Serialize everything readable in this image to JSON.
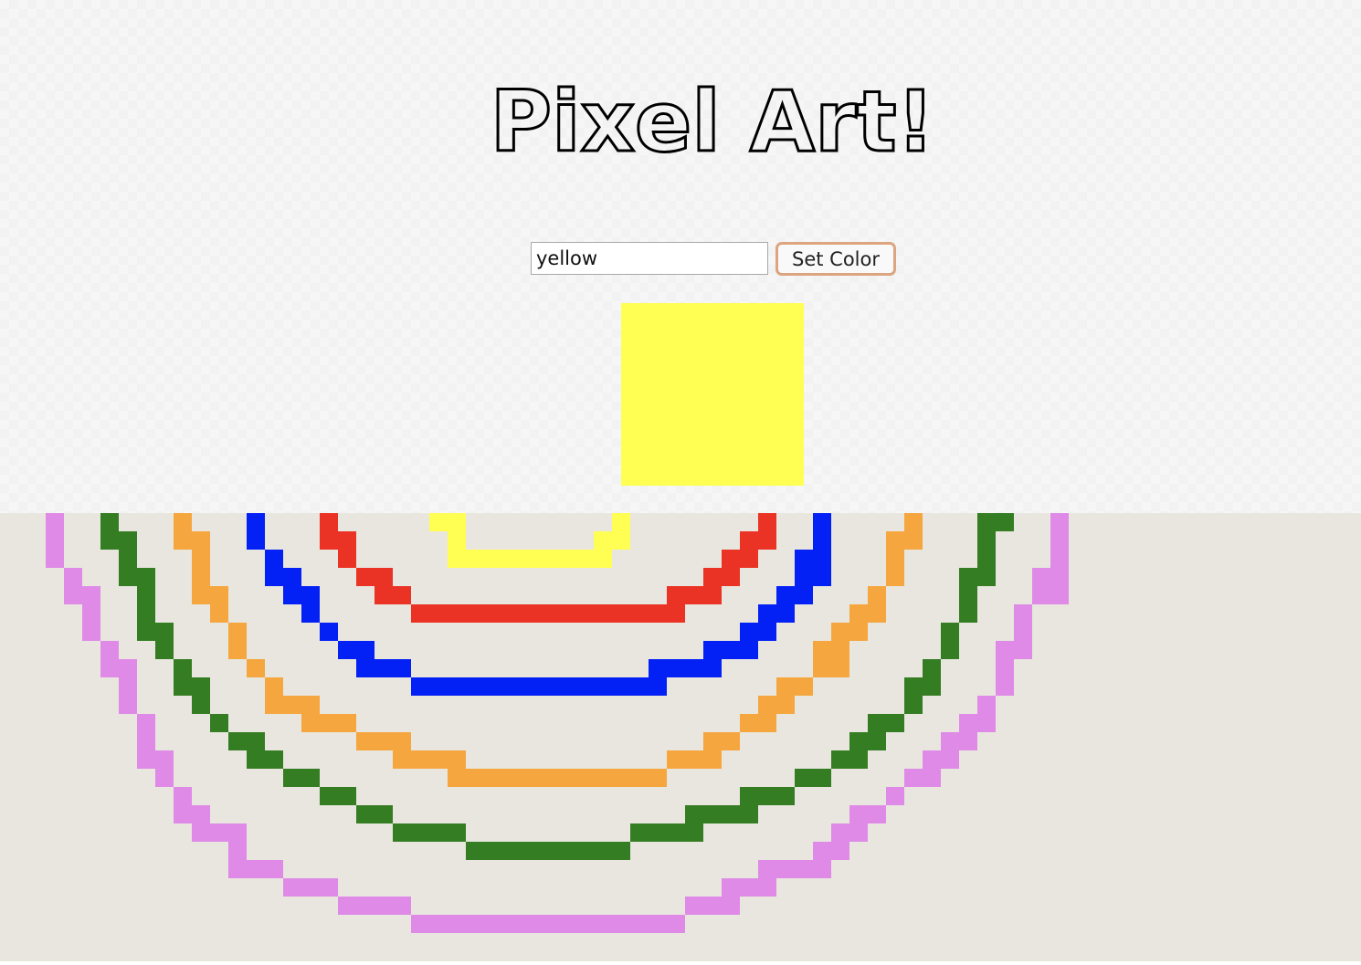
{
  "title": "Pixel Art!",
  "color_input": {
    "value": "yellow"
  },
  "set_color_button": {
    "label": "Set Color"
  },
  "preview": {
    "color": "#fffe52"
  },
  "canvas": {
    "background": "#e8e6df",
    "arcs": [
      {
        "name": "pink",
        "color": "#df8ae7"
      },
      {
        "name": "green",
        "color": "#357d22"
      },
      {
        "name": "orange",
        "color": "#f5a63e"
      },
      {
        "name": "blue",
        "color": "#0421f5"
      },
      {
        "name": "red",
        "color": "#ea3324"
      },
      {
        "name": "yellow",
        "color": "#fffe52"
      }
    ]
  }
}
